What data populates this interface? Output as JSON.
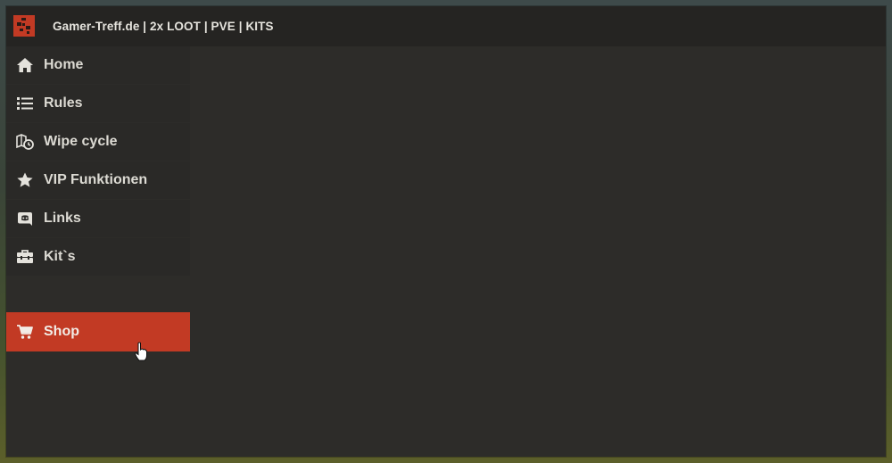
{
  "window": {
    "title": "Gamer-Treff.de | 2x LOOT | PVE | KITS",
    "logo_icon": "rust-logo-icon"
  },
  "sidebar": {
    "items": [
      {
        "label": "Home",
        "icon": "home-icon"
      },
      {
        "label": "Rules",
        "icon": "list-icon"
      },
      {
        "label": "Wipe cycle",
        "icon": "map-clock-icon"
      },
      {
        "label": "VIP Funktionen",
        "icon": "star-icon"
      },
      {
        "label": "Links",
        "icon": "discord-icon"
      },
      {
        "label": "Kit`s",
        "icon": "toolbox-icon"
      }
    ],
    "shop": {
      "label": "Shop",
      "icon": "cart-icon",
      "active": true
    }
  },
  "colors": {
    "accent": "#c23a24",
    "panel": "#2d2c29",
    "titlebar": "#252422",
    "nav_bg": "#2a2927",
    "text": "#dcdad3"
  }
}
